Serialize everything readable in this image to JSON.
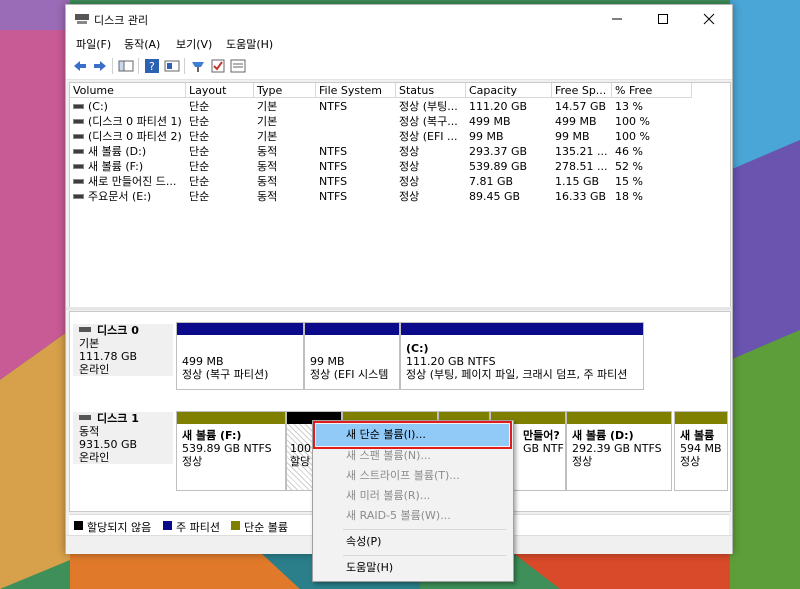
{
  "window": {
    "title": "디스크 관리"
  },
  "menu": [
    "파일(F)",
    "동작(A)",
    "보기(V)",
    "도움말(H)"
  ],
  "columns": [
    "Volume",
    "Layout",
    "Type",
    "File System",
    "Status",
    "Capacity",
    "Free Sp...",
    "% Free"
  ],
  "volumes": [
    [
      "(C:)",
      "단순",
      "기본",
      "NTFS",
      "정상 (부팅...",
      "111.20 GB",
      "14.57 GB",
      "13 %"
    ],
    [
      "(디스크 0 파티션 1)",
      "단순",
      "기본",
      "",
      "정상 (복구...",
      "499 MB",
      "499 MB",
      "100 %"
    ],
    [
      "(디스크 0 파티션 2)",
      "단순",
      "기본",
      "",
      "정상 (EFI ...",
      "99 MB",
      "99 MB",
      "100 %"
    ],
    [
      "새 볼륨 (D:)",
      "단순",
      "동적",
      "NTFS",
      "정상",
      "293.37 GB",
      "135.21 ...",
      "46 %"
    ],
    [
      "새 볼륨 (F:)",
      "단순",
      "동적",
      "NTFS",
      "정상",
      "539.89 GB",
      "278.51 ...",
      "52 %"
    ],
    [
      "새로 만들어진 드...",
      "단순",
      "동적",
      "NTFS",
      "정상",
      "7.81 GB",
      "1.15 GB",
      "15 %"
    ],
    [
      "주요문서 (E:)",
      "단순",
      "동적",
      "NTFS",
      "정상",
      "89.45 GB",
      "16.33 GB",
      "18 %"
    ]
  ],
  "disk0": {
    "name": "디스크 0",
    "type": "기본",
    "size": "111.78 GB",
    "state": "온라인",
    "p1": {
      "size": "499 MB",
      "status": "정상 (복구 파티션)"
    },
    "p2": {
      "size": "99 MB",
      "status": "정상 (EFI 시스템"
    },
    "p3": {
      "name": "(C:)",
      "size": "111.20 GB NTFS",
      "status": "정상 (부팅, 페이지 파일, 크래시 덤프, 주 파티션"
    }
  },
  "disk1": {
    "name": "디스크 1",
    "type": "동적",
    "size": "931.50 GB",
    "state": "온라인",
    "f": {
      "name": "새 볼륨  (F:)",
      "size": "539.89 GB NTFS",
      "status": "정상"
    },
    "u": {
      "size": "100",
      "status": "할당"
    },
    "n": {
      "name": "만들어?",
      "size": "GB NTF"
    },
    "d": {
      "name": "새 볼륨  (D:)",
      "size": "292.39 GB NTFS",
      "status": "정상"
    },
    "last": {
      "name": "새 볼륨",
      "size": "594 MB",
      "status": "정상"
    }
  },
  "legend": [
    "할당되지 않음",
    "주 파티션",
    "단순 볼륨"
  ],
  "context_menu": {
    "items": [
      {
        "label": "새 단순 볼륨(I)...",
        "state": "highlighted"
      },
      {
        "label": "새 스팬 볼륨(N)...",
        "state": "disabled"
      },
      {
        "label": "새 스트라이프 볼륨(T)...",
        "state": "disabled"
      },
      {
        "label": "새 미러 볼륨(R)...",
        "state": "disabled"
      },
      {
        "label": "새 RAID-5 볼륨(W)...",
        "state": "disabled"
      },
      {
        "label": "속성(P)",
        "state": "enabled"
      },
      {
        "label": "도움말(H)",
        "state": "enabled"
      }
    ]
  },
  "colors": {
    "primary": "#0a0a8a",
    "simple": "#7f7f00",
    "unallocated": "#000000",
    "highlight": "#91c9f7"
  }
}
